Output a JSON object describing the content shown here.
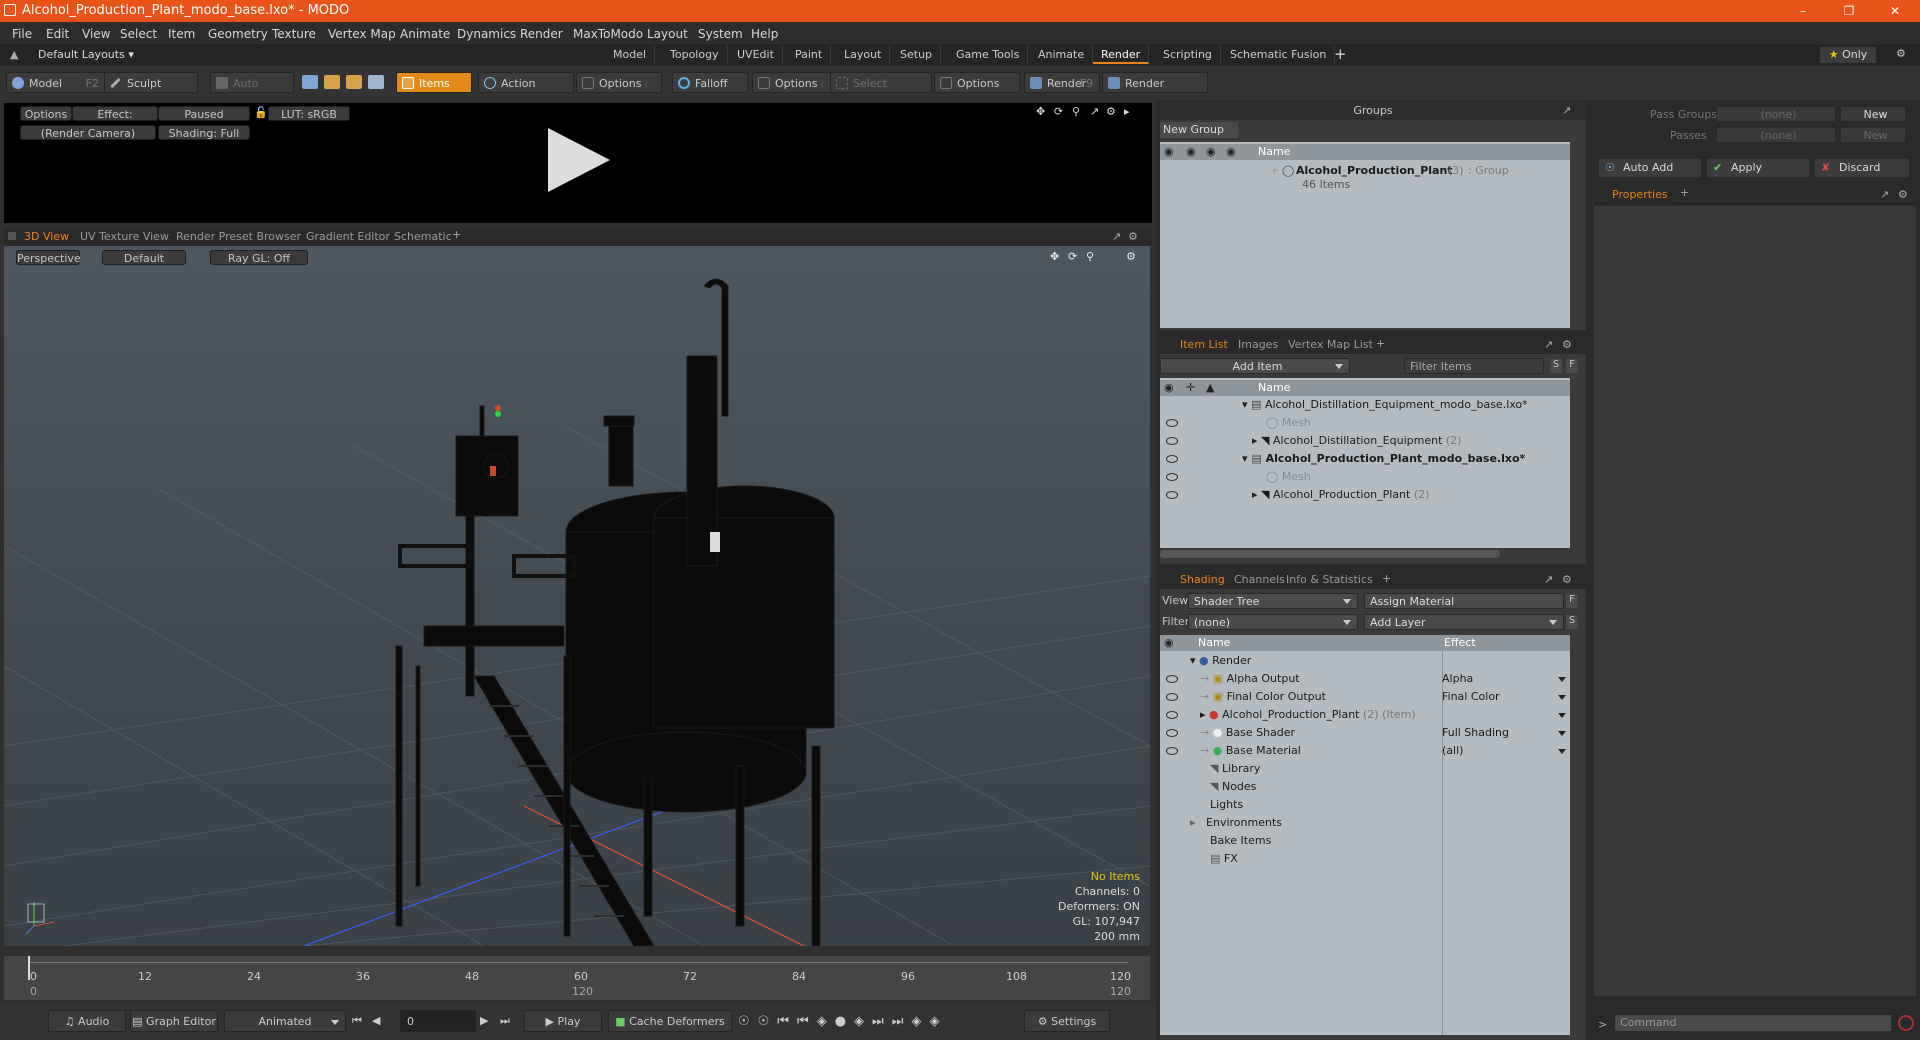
{
  "window": {
    "title": "Alcohol_Production_Plant_modo_base.lxo* - MODO"
  },
  "menu": [
    "File",
    "Edit",
    "View",
    "Select",
    "Item",
    "Geometry",
    "Texture",
    "Vertex Map",
    "Animate",
    "Dynamics",
    "Render",
    "MaxToModo",
    "Layout",
    "System",
    "Help"
  ],
  "layouts": {
    "default_label": "Default Layouts",
    "tabs": [
      "Model",
      "Topology",
      "UVEdit",
      "Paint",
      "Layout",
      "Setup",
      "Game Tools",
      "Animate",
      "Render",
      "Scripting",
      "Schematic Fusion"
    ],
    "active_tab": "Render",
    "only_label": "Only"
  },
  "toolbar": {
    "model": "Model",
    "model_key": "F2",
    "sculpt": "Sculpt",
    "auto_select": "Auto Select",
    "items": "Items",
    "action_center": "Action Center",
    "options1": "Options",
    "falloff": "Falloff",
    "options2": "Options",
    "select_through": "Select Through",
    "options3": "Options",
    "render": "Render",
    "render_key": "F9",
    "render_window": "Render Window"
  },
  "preview": {
    "options": "Options",
    "effect": "Effect: (Shadi...",
    "paused": "Paused",
    "lut": "LUT: sRGB",
    "camera": "(Render Camera)",
    "shading": "Shading: Full"
  },
  "view_tabs": [
    "3D View",
    "UV Texture View",
    "Render Preset Browser",
    "Gradient Editor",
    "Schematic"
  ],
  "viewport": {
    "perspective": "Perspective",
    "default": "Default",
    "raygl": "Ray GL: Off",
    "stats": {
      "no_items": "No Items",
      "channels": "Channels: 0",
      "deformers": "Deformers: ON",
      "gl": "GL: 107,947",
      "size": "200 mm"
    }
  },
  "timeline": {
    "ticks": [
      "0",
      "12",
      "24",
      "36",
      "48",
      "60",
      "72",
      "84",
      "96",
      "108",
      "120"
    ],
    "sub_ticks": [
      "0",
      "120",
      "120"
    ]
  },
  "bottom": {
    "audio": "Audio",
    "graph_editor": "Graph Editor",
    "animated": "Animated",
    "frame": "0",
    "play": "Play",
    "cache_deformers": "Cache Deformers",
    "settings": "Settings"
  },
  "groups": {
    "title": "Groups",
    "new_group": "New Group",
    "name_col": "Name",
    "item_name": "Alcohol_Production_Plant",
    "item_count": "(3)",
    "item_type": ": Group",
    "item_sub": "46 Items"
  },
  "item_list": {
    "tabs": [
      "Item List",
      "Images",
      "Vertex Map List"
    ],
    "add_item": "Add Item",
    "filter_items": "Filter Items",
    "name_col": "Name",
    "rows": [
      {
        "label": "Alcohol_Distillation_Equipment_modo_base.lxo*",
        "count": "",
        "bold": false
      },
      {
        "label": "Mesh",
        "count": "",
        "bold": false
      },
      {
        "label": "Alcohol_Distillation_Equipment",
        "count": "(2)",
        "bold": false
      },
      {
        "label": "Alcohol_Production_Plant_modo_base.lxo*",
        "count": "",
        "bold": true
      },
      {
        "label": "Mesh",
        "count": "",
        "bold": false
      },
      {
        "label": "Alcohol_Production_Plant",
        "count": "(2)",
        "bold": false
      }
    ]
  },
  "shading": {
    "tabs": [
      "Shading",
      "Channels",
      "Info & Statistics"
    ],
    "view_label": "View",
    "view_value": "Shader Tree",
    "assign_material": "Assign Material",
    "filter_label": "Filter",
    "filter_value": "(none)",
    "add_layer": "Add Layer",
    "name_col": "Name",
    "effect_col": "Effect",
    "rows": [
      {
        "name": "Render",
        "effect": ""
      },
      {
        "name": "Alpha Output",
        "effect": "Alpha"
      },
      {
        "name": "Final Color Output",
        "effect": "Final Color"
      },
      {
        "name": "Alcohol_Production_Plant",
        "extra": "(2) (Item)",
        "effect": ""
      },
      {
        "name": "Base Shader",
        "effect": "Full Shading"
      },
      {
        "name": "Base Material",
        "effect": "(all)"
      },
      {
        "name": "Library",
        "effect": ""
      },
      {
        "name": "Nodes",
        "effect": ""
      },
      {
        "name": "Lights",
        "effect": ""
      },
      {
        "name": "Environments",
        "effect": ""
      },
      {
        "name": "Bake Items",
        "effect": ""
      },
      {
        "name": "FX",
        "effect": ""
      }
    ]
  },
  "passes": {
    "pass_groups": "Pass Groups",
    "passes": "Passes",
    "none": "(none)",
    "new": "New",
    "auto_add": "Auto Add",
    "apply": "Apply",
    "discard": "Discard",
    "properties": "Properties"
  },
  "command": {
    "placeholder": "Command"
  }
}
